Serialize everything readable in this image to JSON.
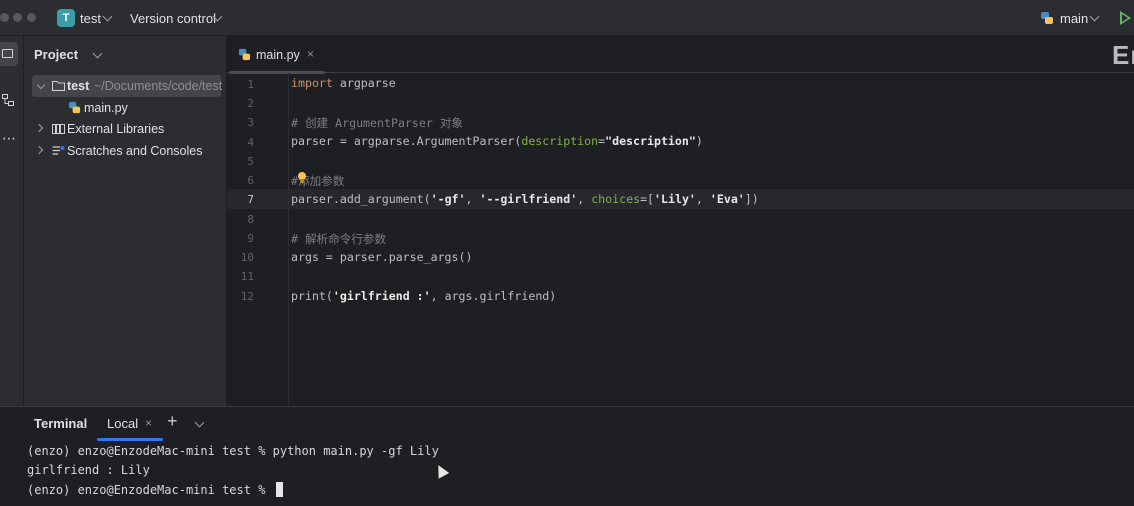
{
  "titlebar": {
    "project_badge": "T",
    "project_name": "test",
    "vcs_label": "Version control",
    "branch": "main",
    "icons": [
      "chevron-down-icon",
      "python-icon",
      "run-icon"
    ]
  },
  "project_panel": {
    "header": "Project",
    "tree": [
      {
        "label": "test",
        "path": "~/Documents/code/test",
        "expanded": true,
        "icon": "folder-icon"
      },
      {
        "label": "main.py",
        "icon": "python-file-icon"
      },
      {
        "label": "External Libraries",
        "expanded": false,
        "icon": "library-icon"
      },
      {
        "label": "Scratches and Consoles",
        "expanded": false,
        "icon": "scratches-icon"
      }
    ]
  },
  "editor": {
    "tab": {
      "label": "main.py",
      "close": "×"
    },
    "right_fragment": "Er",
    "current_line": 7,
    "line_numbers": [
      "1",
      "2",
      "3",
      "4",
      "5",
      "6",
      "7",
      "8",
      "9",
      "10",
      "11",
      "12"
    ],
    "lines": {
      "l1_kw": "import",
      "l1_rest": " argparse",
      "l3_comment": "# 创建 ArgumentParser 对象",
      "l4_a": "parser = argparse.ArgumentParser(",
      "l4_param": "description",
      "l4_eq": "=",
      "l4_str": "\"description\"",
      "l4_close": ")",
      "l6_hash": "#",
      "l6_comment": "添加参数",
      "l7_a": "parser.add_argument(",
      "l7_s1": "'-gf'",
      "l7_c1": ", ",
      "l7_s2": "'--girlfriend'",
      "l7_c2": ", ",
      "l7_kw": "choices",
      "l7_eq": "=[",
      "l7_s3": "'Lily'",
      "l7_c3": ", ",
      "l7_s4": "'Eva'",
      "l7_close": "])",
      "l9_comment": "# 解析命令行参数",
      "l10": "args = parser.parse_args()",
      "l12_a": "print(",
      "l12_str": "'girlfriend :'",
      "l12_b": ", args.girlfriend)"
    }
  },
  "terminal": {
    "title": "Terminal",
    "tab": "Local",
    "close": "×",
    "add": "+",
    "lines": [
      "(enzo) enzo@EnzodeMac-mini test % python main.py -gf Lily",
      "girlfriend : Lily",
      "(enzo) enzo@EnzodeMac-mini test % "
    ]
  },
  "colors": {
    "accent": "#3574f0",
    "keyword": "#cf8e6d",
    "comment": "#7a7e85",
    "kwarg": "#7fb347",
    "param": "#56a8f5",
    "project_badge": "#3c9ca8",
    "run": "#5fb865"
  }
}
